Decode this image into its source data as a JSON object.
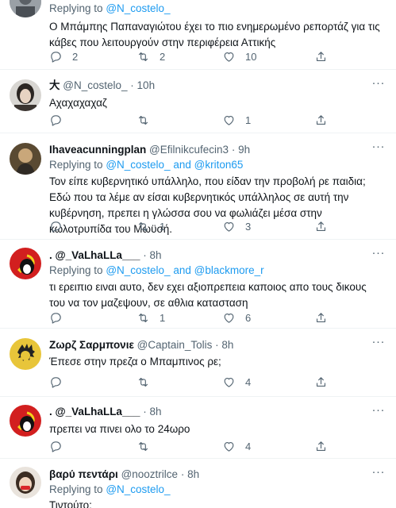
{
  "tweets": [
    {
      "reply_prefix": "Replying to",
      "reply_to": [
        "@N_costelo_"
      ],
      "reply_joiner": "",
      "text": "Ο Μπάμπης Παπαναγιώτου έχει το πιο ενημερωμένο ρεπορτάζ για τις κάβες που λειτουργούν στην περιφέρεια Αττικής",
      "replies": "2",
      "retweets": "2",
      "likes": "10"
    },
    {
      "display_name": "大",
      "handle": "@N_costelo_",
      "time": "10h",
      "text": "Αχαχαχαχαζ",
      "replies": "",
      "retweets": "",
      "likes": "1"
    },
    {
      "display_name": "Ihaveacunningplan",
      "handle": "@Efilnikcufecin3",
      "time": "9h",
      "reply_prefix": "Replying to",
      "reply_to": [
        "@N_costelo_",
        "@kriton65"
      ],
      "reply_joiner": "and",
      "text": "Τον είπε κυβερνητικό υπάλληλο, που είδαν την προβολή ρε παιδια; Εδώ που τα λέμε αν είσαι κυβερνητικός υπάλληλος σε αυτή την κυβέρνηση, πρεπει η γλώσσα σου να φωλιάζει μέσα στην κωλοτρυπίδα του Μωϋσή.",
      "replies": "",
      "retweets": "1",
      "likes": "3"
    },
    {
      "display_name": ". @_VaLhaLLa___",
      "handle": "",
      "time": "8h",
      "reply_prefix": "Replying to",
      "reply_to": [
        "@N_costelo_",
        "@blackmore_r"
      ],
      "reply_joiner": "and",
      "text": "τι ερειπιο ειναι αυτο, δεν εχει αξιοπρεπεια καποιος απο τους δικους του να τον μαζεψουν, σε αθλια κατασταση",
      "replies": "",
      "retweets": "1",
      "likes": "6"
    },
    {
      "display_name": "Ζωρζ Σαρμπονιε",
      "handle": "@Captain_Tolis",
      "time": "8h",
      "text": "Έπεσε στην πρεζα ο Μπαμπινος ρε;",
      "replies": "",
      "retweets": "",
      "likes": "4"
    },
    {
      "display_name": ". @_VaLhaLLa___",
      "handle": "",
      "time": "8h",
      "text": "πρεπει να πινει ολο το 24ωρο",
      "replies": "",
      "retweets": "",
      "likes": "4"
    },
    {
      "display_name": "βαρύ πεντάρι",
      "handle": "@nooztrilce",
      "time": "8h",
      "reply_prefix": "Replying to",
      "reply_to": [
        "@N_costelo_"
      ],
      "reply_joiner": "",
      "text": "Τιντούτο;"
    }
  ],
  "icons": {
    "reply": "reply-icon",
    "retweet": "retweet-icon",
    "like": "like-icon",
    "share": "share-icon",
    "more": "more-icon"
  },
  "colors": {
    "link": "#1d9bf0",
    "muted": "#536471",
    "text": "#0f1419",
    "divider": "#eff3f4"
  }
}
